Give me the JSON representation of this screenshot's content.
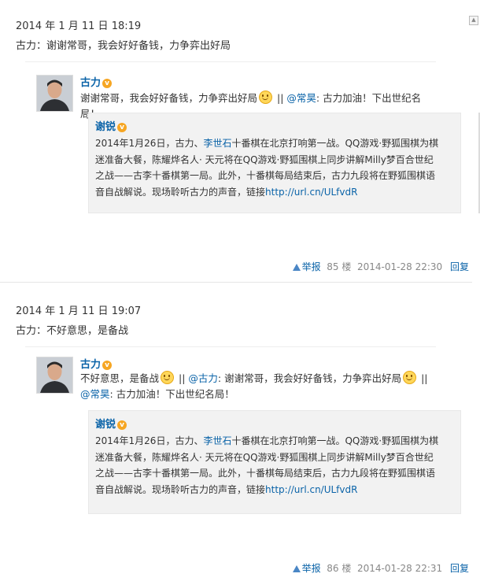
{
  "posts": [
    {
      "date": "2014 年 1 月 11 日 18:19",
      "text": "古力：谢谢常哥，我会好好备钱，力争弈出好局",
      "weibo": {
        "author": "古力",
        "body_a": "谢谢常哥，我会好好备钱，力争弈出好局",
        "body_b": " || ",
        "mention1": "@常昊",
        "body_c": ": 古力加油！下出世纪名局！",
        "quote": {
          "author": "谢锐",
          "text_a": "2014年1月26日，古力、",
          "mention": "李世石",
          "text_b": "十番棋在北京打响第一战。QQ游戏·野狐围棋为棋迷准备大餐，陈耀烨名人· 天元将在QQ游戏·野狐围棋上同步讲解Milly梦百合世纪之战——古李十番棋第一局。此外，十番棋每局结束后，古力九段将在野狐围棋语音自战解说。现场聆听古力的声音，链接",
          "link": "http://url.cn/ULfvdR"
        }
      },
      "footer": {
        "report": "举报",
        "floor": "85 楼",
        "time": "2014-01-28 22:30",
        "reply": "回复"
      }
    },
    {
      "date": "2014 年 1 月 11 日 19:07",
      "text": "古力：不好意思，是备战",
      "weibo": {
        "author": "古力",
        "body_a": "不好意思，是备战",
        "body_b": " || ",
        "mention1": "@古力",
        "body_c": ": 谢谢常哥，我会好好备钱，力争弈出好局",
        "body_d": " || ",
        "mention2": "@常昊",
        "body_e": ": 古力加油！下出世纪名局！",
        "quote": {
          "author": "谢锐",
          "text_a": "2014年1月26日，古力、",
          "mention": "李世石",
          "text_b": "十番棋在北京打响第一战。QQ游戏·野狐围棋为棋迷准备大餐，陈耀烨名人· 天元将在QQ游戏·野狐围棋上同步讲解Milly梦百合世纪之战——古李十番棋第一局。此外，十番棋每局结束后，古力九段将在野狐围棋语音自战解说。现场聆听古力的声音，链接",
          "link": "http://url.cn/ULfvdR"
        }
      },
      "footer": {
        "report": "举报",
        "floor": "86 楼",
        "time": "2014-01-28 22:31",
        "reply": "回复"
      }
    }
  ],
  "icons": {
    "verified": "verified-badge-icon",
    "smile": "smile-emoji-icon",
    "report": "warning-triangle-icon"
  },
  "colors": {
    "link": "#0a63a8",
    "quote_bg": "#f2f2f2",
    "badge": "#f6a623"
  }
}
